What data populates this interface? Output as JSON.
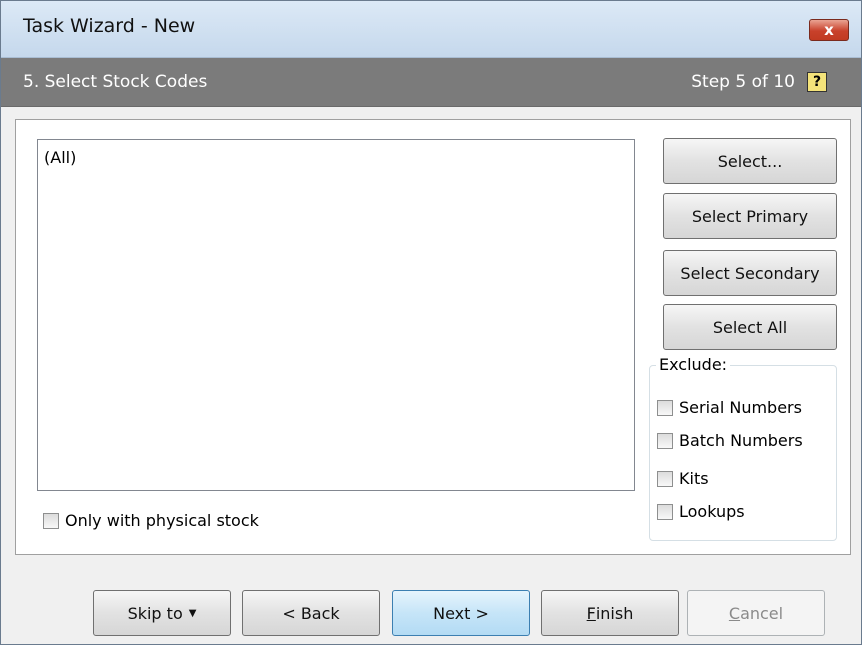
{
  "window": {
    "title": "Task Wizard - New",
    "close_label": "x"
  },
  "stepbar": {
    "title": "5. Select Stock Codes",
    "step_count": "Step 5 of 10",
    "help_icon": "?"
  },
  "stock_list": {
    "items": [
      "(All)"
    ]
  },
  "side_buttons": {
    "select": "Select...",
    "select_primary": "Select Primary",
    "select_secondary": "Select Secondary",
    "select_all": "Select All"
  },
  "exclude": {
    "legend": "Exclude:",
    "options": [
      {
        "label": "Serial Numbers",
        "checked": false
      },
      {
        "label": "Batch Numbers",
        "checked": false
      },
      {
        "label": "Kits",
        "checked": false
      },
      {
        "label": "Lookups",
        "checked": false
      }
    ]
  },
  "physical_stock": {
    "label": "Only with physical stock",
    "checked": false
  },
  "footer": {
    "skip_to": "Skip to",
    "skip_to_arrow": "▼",
    "back": "< Back",
    "next": "Next >",
    "finish_key": "F",
    "finish_rest": "inish",
    "cancel_key": "C",
    "cancel_rest": "ancel"
  },
  "colors": {
    "stepbar_bg": "#7b7b7b",
    "primary_border": "#3c7fb1",
    "close_red": "#c8412b"
  }
}
